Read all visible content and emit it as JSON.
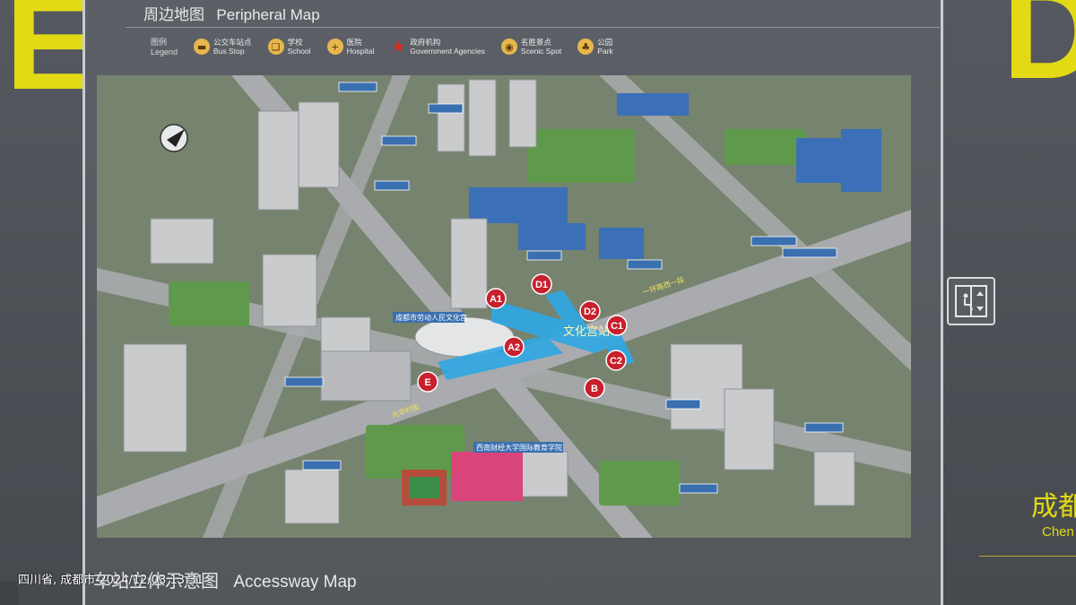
{
  "signage": {
    "left_letter": "E",
    "right_letter": "D",
    "title_cn": "周边地图",
    "title_en": "Peripheral Map",
    "bottom_title_cn": "车站立体示意图",
    "bottom_title_en": "Accessway Map",
    "right_city_cn": "成都",
    "right_city_en": "Chen"
  },
  "legend": {
    "label_cn": "图例",
    "label_en": "Legend",
    "items": [
      {
        "cn": "公交车站点",
        "en": "Bus Stop",
        "icon": "bus-icon"
      },
      {
        "cn": "学校",
        "en": "School",
        "icon": "book-icon"
      },
      {
        "cn": "医院",
        "en": "Hospital",
        "icon": "cross-icon"
      },
      {
        "cn": "政府机构",
        "en": "Government Agencies",
        "icon": "star-icon"
      },
      {
        "cn": "名胜景点",
        "en": "Scenic Spot",
        "icon": "camera-icon"
      },
      {
        "cn": "公园",
        "en": "Park",
        "icon": "tree-icon"
      }
    ]
  },
  "station": {
    "name_cn": "文化宫站",
    "exits": [
      "A1",
      "A2",
      "B",
      "C1",
      "C2",
      "D1",
      "D2",
      "E"
    ]
  },
  "map_labels": {
    "poi_cultural_palace": "成都市劳动人民文化宫",
    "poi_university": "西南财经大学国际教育学院",
    "street_south": "光华村街",
    "street_middle": "一环路西一段"
  },
  "watermark": "四川省, 成都市 2024/12/03 13:31",
  "colors": {
    "sign_yellow": "#e3da14",
    "exit_red": "#c8202d",
    "route_blue": "#2fa8e4",
    "panel_gray": "#5c6066"
  }
}
